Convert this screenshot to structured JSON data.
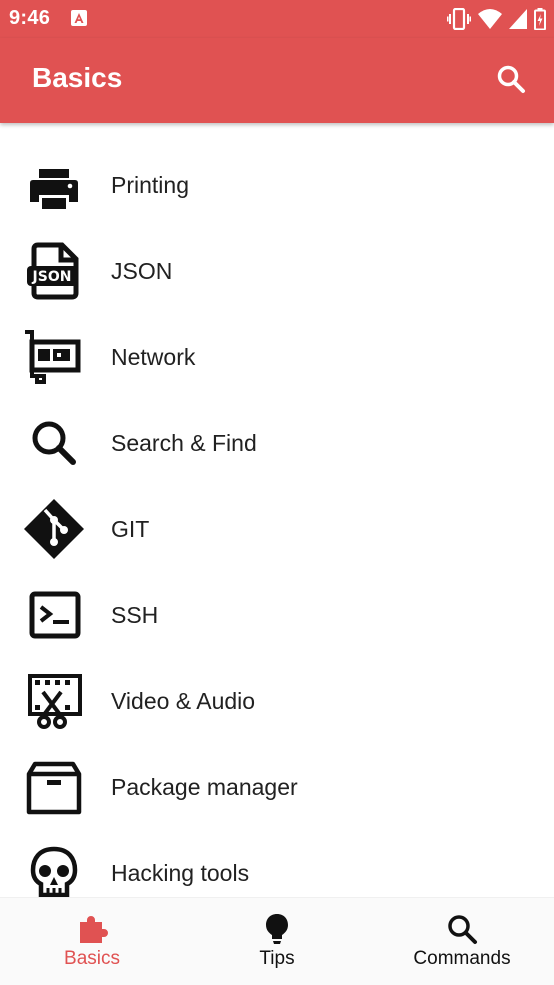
{
  "status_bar": {
    "time": "9:46",
    "icons": [
      "notification-a-icon",
      "vibrate-icon",
      "wifi-icon",
      "cellular-signal-icon",
      "battery-icon"
    ]
  },
  "app_bar": {
    "title": "Basics",
    "search_icon": "search-icon"
  },
  "list": {
    "items": [
      {
        "label": "Printing",
        "icon": "printer-icon"
      },
      {
        "label": "JSON",
        "icon": "json-file-icon"
      },
      {
        "label": "Network",
        "icon": "network-card-icon"
      },
      {
        "label": "Search & Find",
        "icon": "magnify-icon"
      },
      {
        "label": "GIT",
        "icon": "git-icon"
      },
      {
        "label": "SSH",
        "icon": "console-icon"
      },
      {
        "label": "Video & Audio",
        "icon": "video-cut-icon"
      },
      {
        "label": "Package manager",
        "icon": "archive-box-icon"
      },
      {
        "label": "Hacking tools",
        "icon": "skull-icon"
      }
    ]
  },
  "bottom_nav": {
    "items": [
      {
        "label": "Basics",
        "icon": "puzzle-icon",
        "active": true
      },
      {
        "label": "Tips",
        "icon": "lightbulb-icon",
        "active": false
      },
      {
        "label": "Commands",
        "icon": "search-icon",
        "active": false
      }
    ]
  },
  "colors": {
    "primary": "#e05252",
    "text": "#212121",
    "nav_background": "#fafafa"
  }
}
